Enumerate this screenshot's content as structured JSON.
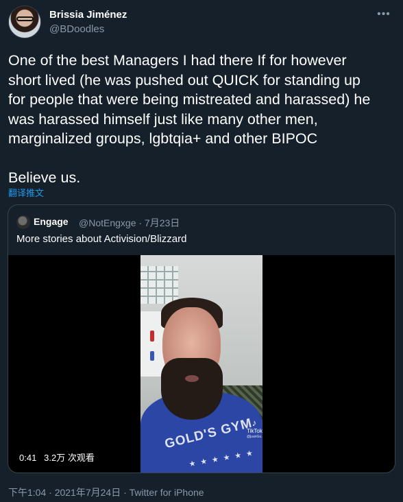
{
  "author": {
    "name": "Brissia Jiménez",
    "handle": "@BDoodles"
  },
  "more_icon": "more-options-icon",
  "tweet": {
    "lines": [
      "One of the best Managers I had there If for however",
      "short lived (he was pushed out QUICK for standing up",
      "for people that were being mistreated and harassed) he",
      "was harassed himself just like many other men,",
      "marginalized groups, lgbtqia+ and other BIPOC",
      "",
      "Believe us."
    ],
    "translate_label": "翻译推文"
  },
  "quoted_tweet": {
    "name": "Engage",
    "meta": "@NotEngxge · 7月23日",
    "text": "More stories about Activision/Blizzard",
    "video": {
      "duration": "0:41",
      "views": "3.2万 次观看",
      "shirt_print": "GOLD'S GYM",
      "stars": "★ ★ ★ ★ ★ ★",
      "watermark_icon": "♪",
      "watermark_label": "TikTok",
      "watermark_handle": "@juanGu..."
    }
  },
  "footer": {
    "timestamp": "下午1:04 · 2021年7月24日 · Twitter for iPhone"
  },
  "colors": {
    "background": "#15202b",
    "link": "#1d9bf0",
    "secondary_text": "#8b98a5",
    "border": "#38444d"
  }
}
